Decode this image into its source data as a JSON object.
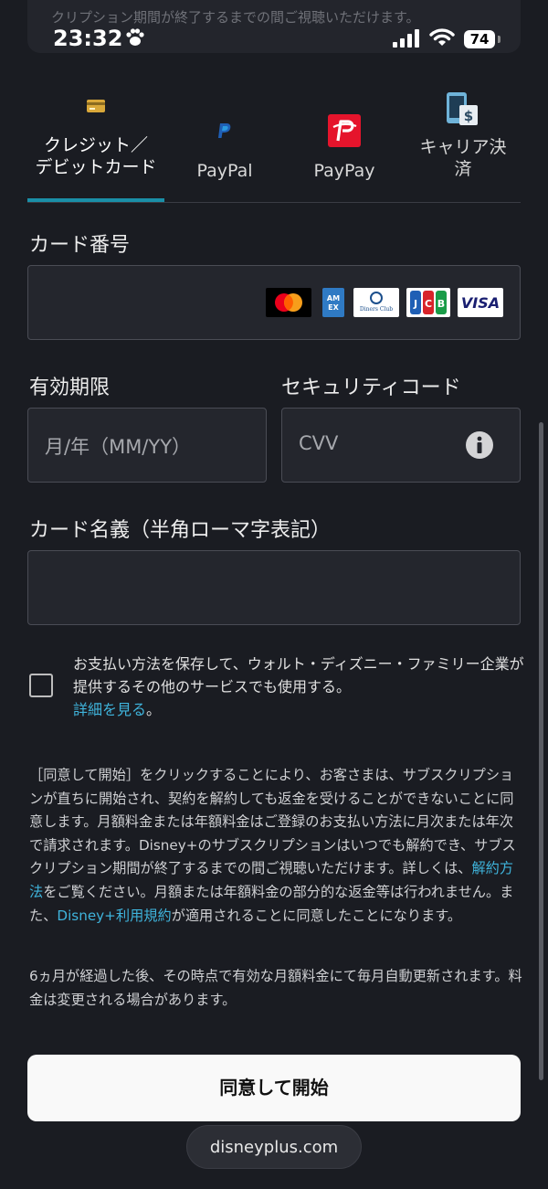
{
  "status_bar": {
    "time": "23:32",
    "battery": "74",
    "icons": [
      "paw-icon",
      "signal-icon",
      "wifi-icon",
      "battery-icon"
    ]
  },
  "top_fade_text": "クリプション期間が終了するまでの間ご視聴いただけます。",
  "tabs": [
    {
      "label": "クレジット／\nデビットカード",
      "icon": "credit-card-icon"
    },
    {
      "label": "PayPal",
      "icon": "paypal-icon"
    },
    {
      "label": "PayPay",
      "icon": "paypay-icon"
    },
    {
      "label": "キャリア決\n済",
      "icon": "carrier-billing-icon"
    }
  ],
  "form": {
    "card_number_label": "カード番号",
    "card_brands": [
      "Mastercard",
      "AMEX",
      "Diners Club",
      "JCB",
      "VISA"
    ],
    "expiry_label": "有効期限",
    "expiry_placeholder": "月/年（MM/YY）",
    "security_label": "セキュリティコード",
    "cvv_placeholder": "CVV",
    "name_label": "カード名義（半角ローマ字表記）"
  },
  "save_payment": {
    "text": "お支払い方法を保存して、ウォルト・ディズニー・ファミリー企業が提供するその他のサービスでも使用する。",
    "link": "詳細を見る",
    "suffix": "。"
  },
  "legal": {
    "part1": "［同意して開始］をクリックすることにより、お客さまは、サブスクリプションが直ちに開始され、契約を解約しても返金を受けることができないことに同意します。月額料金または年額料金はご登録のお支払い方法に月次または年次で請求されます。Disney+のサブスクリプションはいつでも解約でき、サブスクリプション期間が終了するまでの間ご視聴いただけます。詳しくは、",
    "link1": "解約方法",
    "part2": "をご覧ください。月額または年額料金の部分的な返金等は行われません。また、",
    "link2": "Disney+利用規約",
    "part3": "が適用されることに同意したことになります。"
  },
  "renew_text": "6ヵ月が経過した後、その時点で有効な月額料金にて毎月自動更新されます。料金は変更される場合があります。",
  "agree_button": "同意して開始",
  "url": "disneyplus.com",
  "colors": {
    "background": "#1a1c22",
    "accent": "#1a8fa8",
    "link": "#3fb4dc",
    "paypay_red": "#e5142c"
  }
}
